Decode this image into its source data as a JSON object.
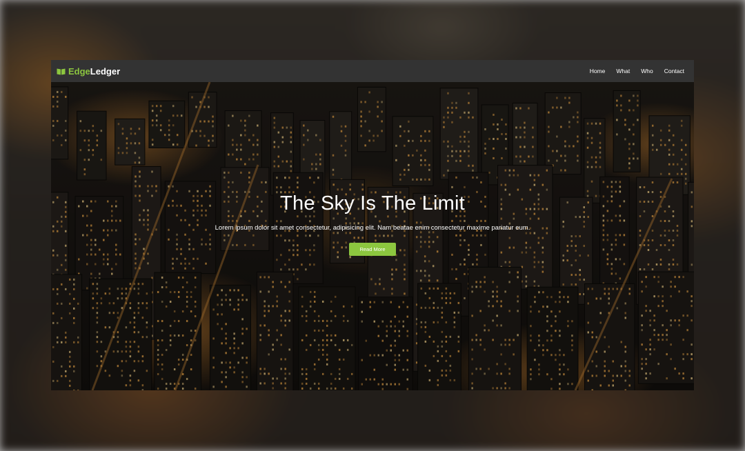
{
  "nav": {
    "brand_part1": "Edge",
    "brand_part2": "Ledger",
    "brand_icon": "open-book-icon",
    "links": [
      "Home",
      "What",
      "Who",
      "Contact"
    ]
  },
  "hero": {
    "title": "The Sky Is The Limit",
    "subtitle": "Lorem ipsum dolor sit amet consectetur, adipisicing elit. Nam beatae enim consectetur maxime pariatur eum.",
    "button_label": "Read More",
    "background": "night-city-aerial-photo"
  },
  "colors": {
    "accent": "#8cc63f",
    "navbar": "#333333",
    "text": "#ffffff"
  }
}
